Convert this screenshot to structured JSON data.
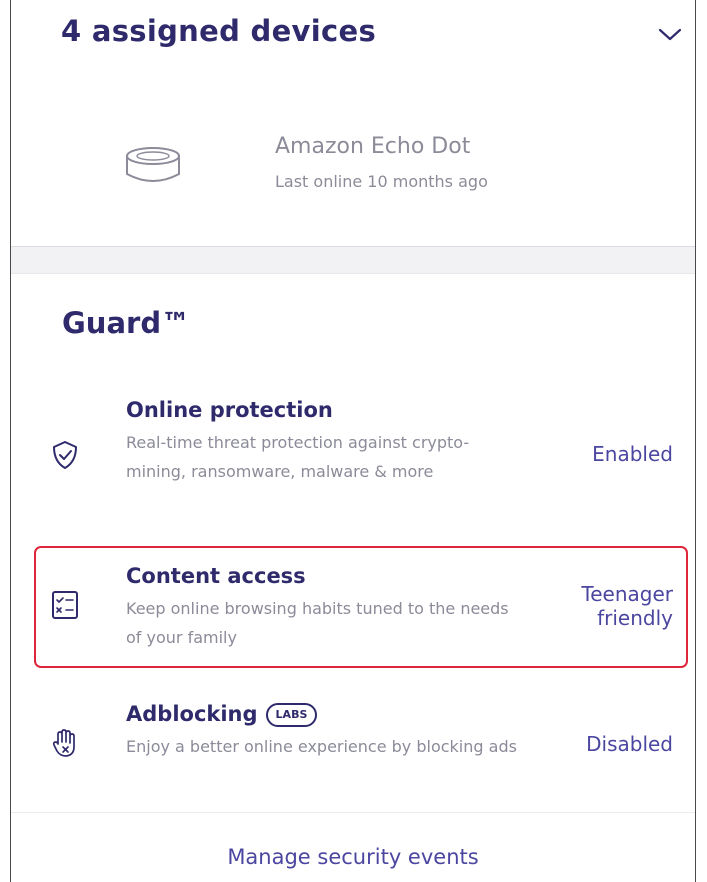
{
  "devices": {
    "title": "4 assigned devices",
    "toggle_icon": "chevron-down-icon",
    "items": [
      {
        "name": "Amazon Echo Dot",
        "status": "Last online 10 months ago",
        "icon": "smart-speaker-icon"
      }
    ]
  },
  "guard": {
    "title": "Guard™",
    "features": [
      {
        "title": "Online protection",
        "description": "Real-time threat protection against crypto-mining, ransomware, malware & more",
        "status": "Enabled",
        "icon": "shield-check-icon"
      },
      {
        "title": "Content access",
        "description": "Keep online browsing habits tuned to the needs of your family",
        "status_line1": "Teenager",
        "status_line2": "friendly",
        "icon": "checklist-icon",
        "highlighted": true
      },
      {
        "title": "Adblocking",
        "badge": "LABS",
        "description": "Enjoy a better online experience by blocking ads",
        "status": "Disabled",
        "icon": "hand-block-icon"
      }
    ]
  },
  "footer": {
    "manage_link": "Manage security events"
  },
  "colors": {
    "heading": "#2e2a6b",
    "muted_text": "#8b8b99",
    "accent": "#4b46a0",
    "highlight_border": "#e0263b"
  }
}
